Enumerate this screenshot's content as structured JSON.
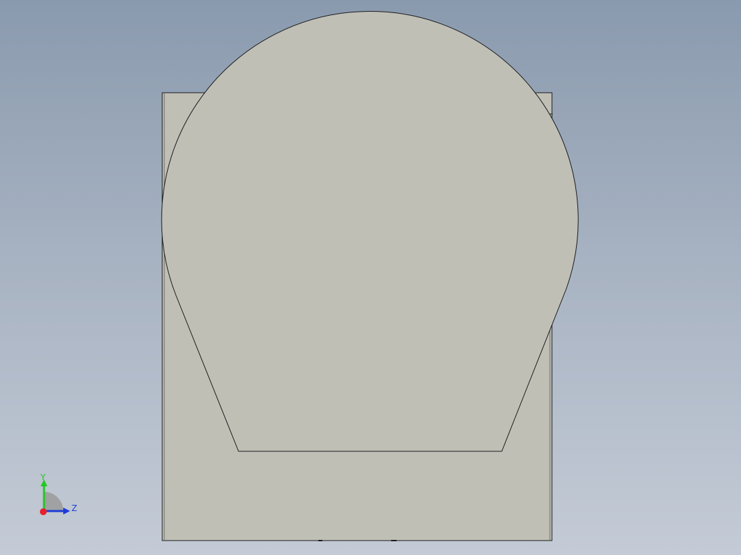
{
  "viewport": {
    "background_top": "#8a9aae",
    "background_bottom": "#c4cbd6"
  },
  "model": {
    "face_color": "#bfbfb6",
    "edge_color": "#1a1a1a"
  },
  "triad": {
    "x_axis_color": "#e8202a",
    "y_axis_color": "#22c822",
    "z_axis_color": "#1e3cd8",
    "labels": {
      "y": "Y",
      "z": "Z"
    }
  }
}
